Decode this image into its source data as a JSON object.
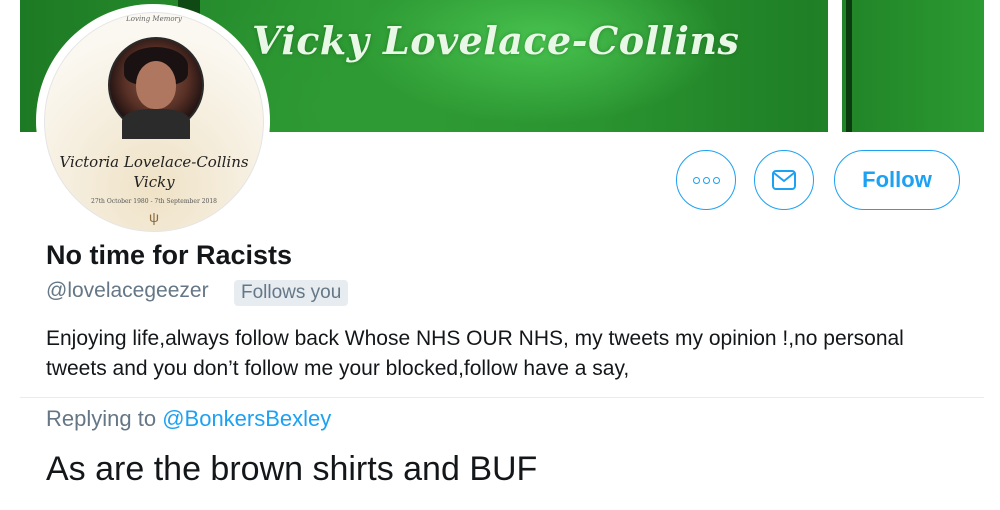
{
  "banner": {
    "title": "Vicky Lovelace-Collins"
  },
  "avatar": {
    "memory_text": "Loving Memory",
    "name_line1": "Victoria Lovelace-Collins",
    "name_line2": "Vicky",
    "dates": "27th October 1980 - 7th September 2018"
  },
  "actions": {
    "more_icon": "more-horizontal-icon",
    "message_icon": "envelope-icon",
    "follow_label": "Follow"
  },
  "profile": {
    "display_name": "No time for Racists",
    "handle": "@lovelacegeezer",
    "follows_you": "Follows you",
    "bio": "Enjoying life,always follow back Whose NHS OUR NHS, my tweets my opinion !,no personal tweets and you don’t follow me your blocked,follow have a say,"
  },
  "tweet": {
    "replying_prefix": "Replying to",
    "replying_to": "@BonkersBexley",
    "text": "As are the brown shirts and BUF"
  },
  "colors": {
    "accent": "#1da1f2",
    "muted": "#657786",
    "banner_green": "#2e9b34"
  }
}
